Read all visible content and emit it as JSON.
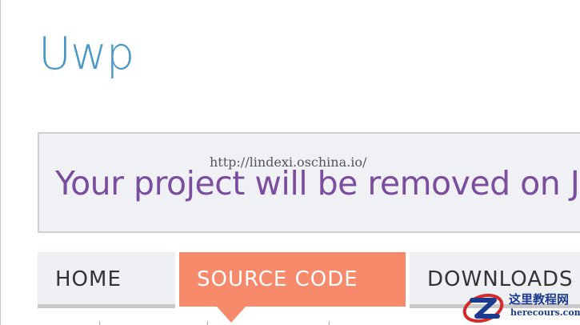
{
  "header": {
    "project_title": "Uwp"
  },
  "notice": {
    "message": "Your project will be removed on Ja"
  },
  "watermark": {
    "url": "http://lindexi.oschina.io/"
  },
  "nav": {
    "tabs": [
      {
        "label": "HOME",
        "active": false
      },
      {
        "label": "SOURCE CODE",
        "active": true
      },
      {
        "label": "DOWNLOADS",
        "active": false
      }
    ]
  },
  "logo": {
    "chinese_text": "这里教程网",
    "site_text": "herecours.com"
  },
  "colors": {
    "title": "#4a97c9",
    "notice_text": "#7b4d9e",
    "notice_bg": "#f0f1f5",
    "active_tab": "#f68a6b",
    "inactive_tab": "#eff0f4"
  }
}
